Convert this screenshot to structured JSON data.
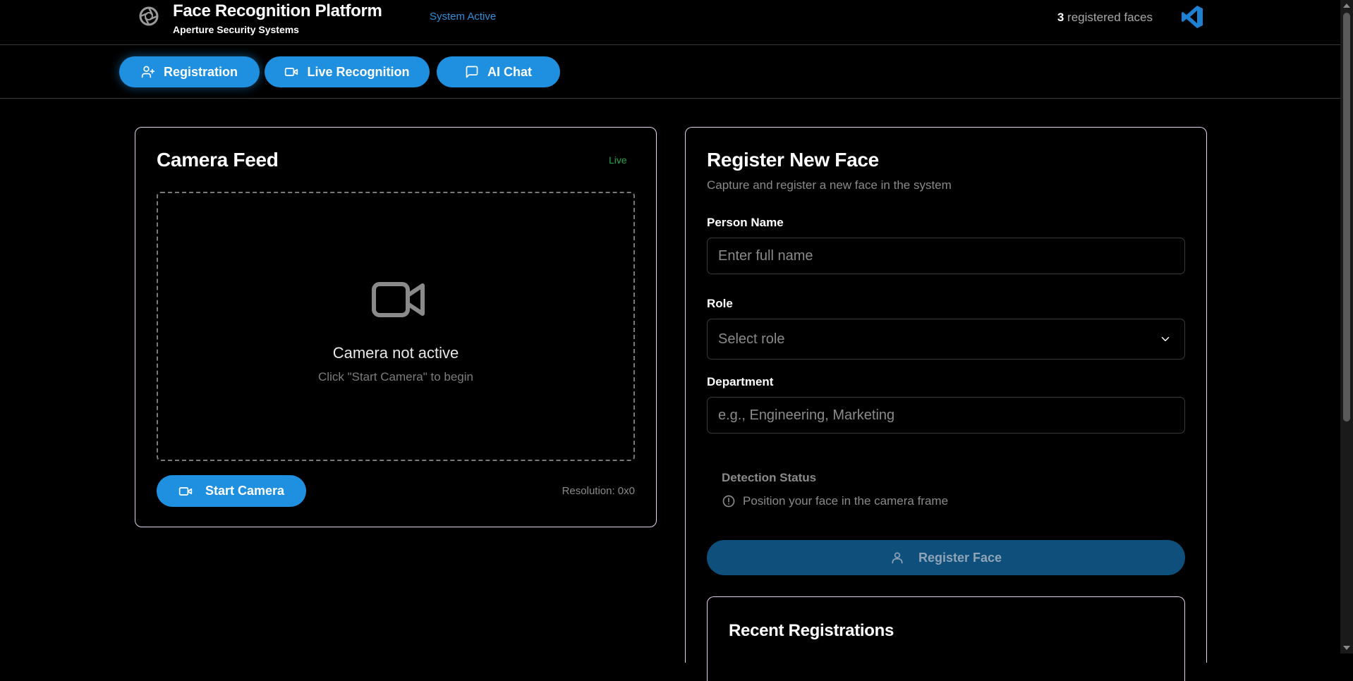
{
  "header": {
    "title": "Face Recognition Platform",
    "subtitle": "Aperture Security Systems",
    "status": "System Active",
    "registered_count": "3",
    "registered_suffix": "registered faces",
    "logo_icon": "aperture-icon",
    "brand_icon": "vscode-icon"
  },
  "nav": {
    "tabs": [
      {
        "label": "Registration",
        "icon": "user-plus-icon",
        "active": true
      },
      {
        "label": "Live Recognition",
        "icon": "video-icon",
        "active": false
      },
      {
        "label": "AI Chat",
        "icon": "message-square-icon",
        "active": false
      }
    ]
  },
  "camera": {
    "title": "Camera Feed",
    "live_label": "Live",
    "inactive_message": "Camera not active",
    "inactive_hint": "Click \"Start Camera\" to begin",
    "start_button": "Start Camera",
    "resolution": "Resolution: 0x0"
  },
  "register": {
    "title": "Register New Face",
    "subtitle": "Capture and register a new face in the system",
    "name_label": "Person Name",
    "name_placeholder": "Enter full name",
    "role_label": "Role",
    "role_value": "Select role",
    "department_label": "Department",
    "department_placeholder": "e.g., Engineering, Marketing",
    "detection_title": "Detection Status",
    "detection_message": "Position your face in the camera frame",
    "register_button": "Register Face",
    "recent_title": "Recent Registrations"
  },
  "colors": {
    "accent": "#1f8fe0",
    "live_green": "#1ea34a",
    "status_blue": "#2d8fd9",
    "disabled_button": "#0f4f7c"
  }
}
